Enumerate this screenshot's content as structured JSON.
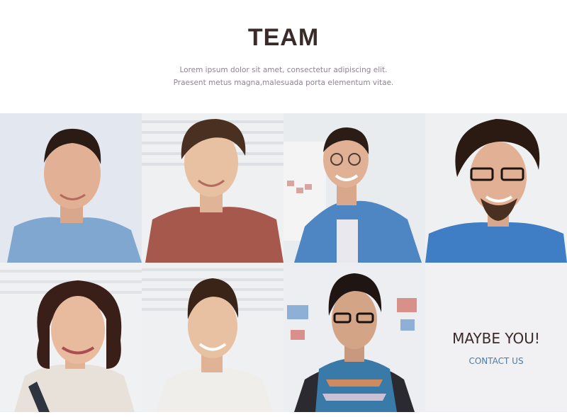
{
  "header": {
    "title": "TEAM",
    "subtitle": "Lorem ipsum dolor sit amet, consectetur adipiscing elit. Praesent metus magna,malesuada porta elementum vitae."
  },
  "team": {
    "members": [
      {
        "photo": "team-member-photo-1",
        "shirt_color": "#7fa7cf",
        "hair_color": "#2a1c15"
      },
      {
        "photo": "team-member-photo-2",
        "shirt_color": "#a5584b",
        "hair_color": "#4a3020"
      },
      {
        "photo": "team-member-photo-3",
        "shirt_color": "#4d86c3",
        "hair_color": "#2b1d16"
      },
      {
        "photo": "team-member-photo-4",
        "shirt_color": "#3f7ec4",
        "hair_color": "#2a1a12"
      },
      {
        "photo": "team-member-photo-5",
        "shirt_color": "#e8e1d9",
        "hair_color": "#3a1f18"
      },
      {
        "photo": "team-member-photo-6",
        "shirt_color": "#f0eeea",
        "hair_color": "#3a2418"
      },
      {
        "photo": "team-member-photo-7",
        "shirt_color": "#3a7aa8",
        "hair_color": "#1f1512"
      }
    ]
  },
  "cta": {
    "title": "MAYBE YOU!",
    "link": "CONTACT US"
  },
  "colors": {
    "title": "#3b2a2a",
    "body_text": "#8e8391",
    "link": "#4a7ba6",
    "cta_background": "#f1f1f3"
  }
}
